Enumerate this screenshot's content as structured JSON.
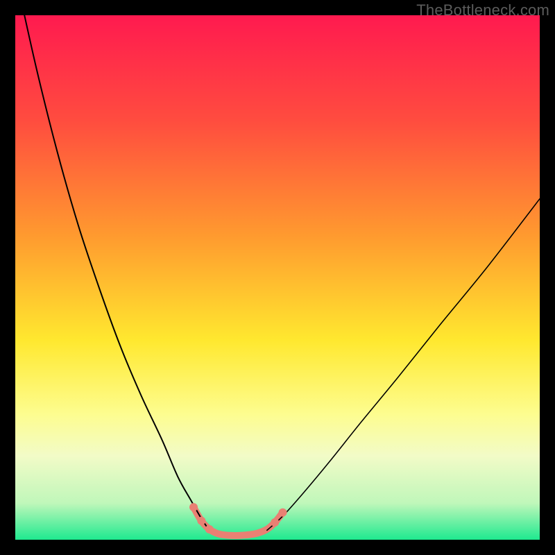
{
  "watermark": "TheBottleneck.com",
  "chart_data": {
    "type": "line",
    "title": "",
    "xlabel": "",
    "ylabel": "",
    "xlim": [
      0,
      100
    ],
    "ylim": [
      0,
      100
    ],
    "grid": false,
    "legend": false,
    "background_gradient": {
      "type": "vertical",
      "stops": [
        {
          "offset": 0.0,
          "color": "#ff1a4f"
        },
        {
          "offset": 0.2,
          "color": "#ff4c3f"
        },
        {
          "offset": 0.42,
          "color": "#ff9a2f"
        },
        {
          "offset": 0.62,
          "color": "#ffe82f"
        },
        {
          "offset": 0.76,
          "color": "#fdfd8f"
        },
        {
          "offset": 0.84,
          "color": "#f2fbc7"
        },
        {
          "offset": 0.93,
          "color": "#c0f7ba"
        },
        {
          "offset": 1.0,
          "color": "#1ee98f"
        }
      ]
    },
    "series": [
      {
        "name": "curve-left",
        "color": "#000000",
        "width": 2.0,
        "x": [
          0,
          4,
          8,
          12,
          16,
          20,
          24,
          28,
          31,
          33.5,
          35.5,
          37
        ],
        "y": [
          108,
          90,
          74,
          60,
          48,
          37,
          27.5,
          19,
          12,
          7.5,
          4,
          1.8
        ]
      },
      {
        "name": "curve-right",
        "color": "#000000",
        "width": 1.6,
        "x": [
          48,
          51,
          55,
          60,
          66,
          73,
          81,
          90,
          100
        ],
        "y": [
          1.8,
          4.5,
          9,
          15,
          22.5,
          31,
          41,
          52,
          65
        ]
      },
      {
        "name": "trough-highlight",
        "color": "#e98073",
        "width": 10,
        "linecap": "round",
        "x": [
          34,
          35.5,
          37,
          38.5,
          40,
          42,
          44,
          46,
          48,
          49.5,
          51
        ],
        "y": [
          6.2,
          3.6,
          2.0,
          1.2,
          0.9,
          0.8,
          0.9,
          1.2,
          2.0,
          3.3,
          5.2
        ]
      }
    ],
    "trough_dots": {
      "color": "#e98073",
      "radius": 6,
      "points": [
        {
          "x": 34,
          "y": 6.2
        },
        {
          "x": 35.5,
          "y": 3.6
        },
        {
          "x": 37,
          "y": 2.0
        },
        {
          "x": 49.5,
          "y": 3.3
        },
        {
          "x": 51,
          "y": 5.2
        }
      ]
    }
  }
}
